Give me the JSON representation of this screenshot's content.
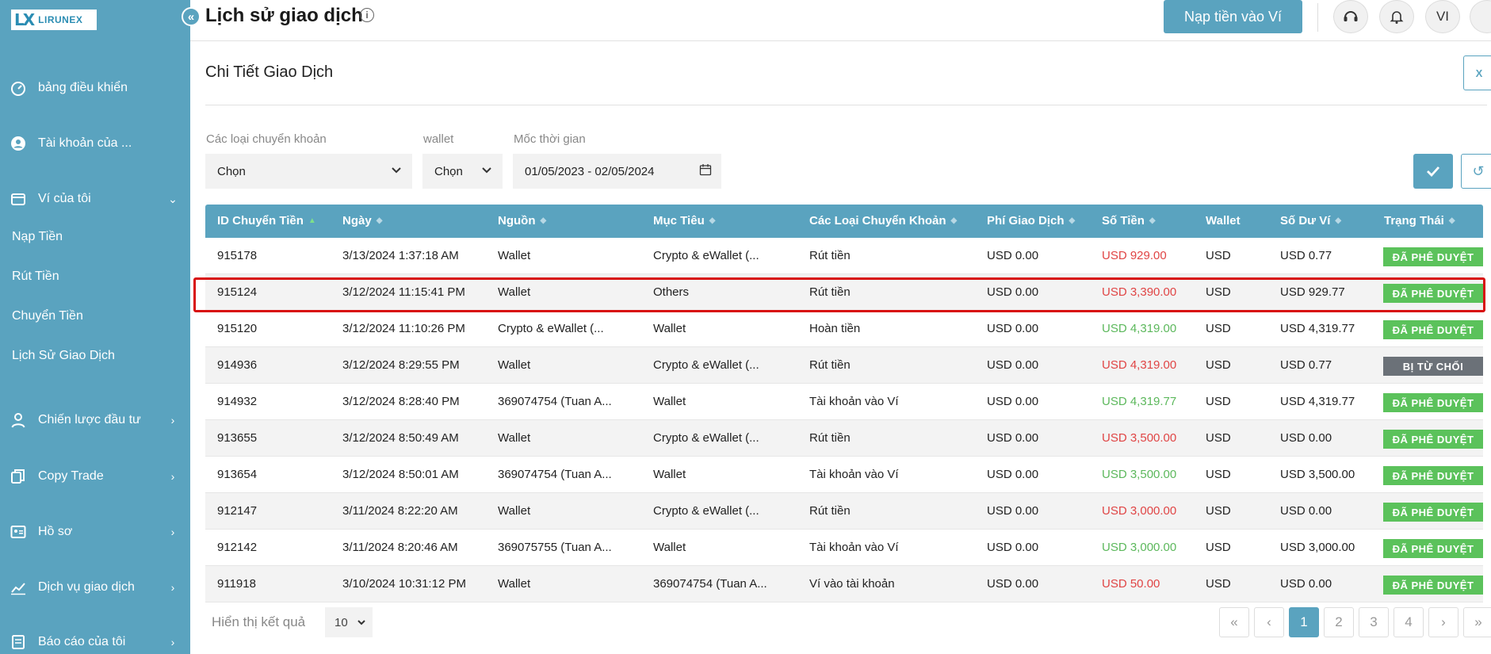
{
  "brand": {
    "logo_mark": "LX",
    "logo_text": "LIRUNEX"
  },
  "sidebar": {
    "items": [
      {
        "label": "bảng điều khiển",
        "icon": "dashboard-icon"
      },
      {
        "label": "Tài khoản của ...",
        "icon": "account-icon"
      },
      {
        "label": "Ví của tôi",
        "icon": "wallet-icon"
      },
      {
        "label": "Chiến lược đầu tư",
        "icon": "strategy-icon"
      },
      {
        "label": "Copy Trade",
        "icon": "copy-icon"
      },
      {
        "label": "Hồ sơ",
        "icon": "profile-icon"
      },
      {
        "label": "Dịch vụ giao dịch",
        "icon": "trading-icon"
      },
      {
        "label": "Báo cáo của tôi",
        "icon": "report-icon"
      }
    ],
    "wallet_subitems": [
      "Nạp Tiền",
      "Rút Tiền",
      "Chuyển Tiền",
      "Lịch Sử Giao Dịch"
    ]
  },
  "header": {
    "title": "Lịch sử giao dịch",
    "deposit_button": "Nạp tiền vào Ví",
    "language": "VI"
  },
  "section": {
    "title": "Chi Tiết Giao Dịch"
  },
  "filters": {
    "transfer_type": {
      "label": "Các loại chuyển khoản",
      "value": "Chọn"
    },
    "wallet": {
      "label": "wallet",
      "value": "Chọn"
    },
    "period": {
      "label": "Mốc thời gian",
      "value": "01/05/2023 - 02/05/2024"
    }
  },
  "table": {
    "columns": [
      "ID Chuyển Tiền",
      "Ngày",
      "Nguồn",
      "Mục Tiêu",
      "Các Loại Chuyển Khoản",
      "Phí Giao Dịch",
      "Số Tiền",
      "Wallet",
      "Số Dư Ví",
      "Trạng Thái"
    ],
    "rows": [
      {
        "id": "915178",
        "date": "3/13/2024 1:37:18 AM",
        "source": "Wallet",
        "target": "Crypto & eWallet (...",
        "type": "Rút tiền",
        "fee": "USD 0.00",
        "amount": "USD 929.00",
        "amount_color": "red",
        "wallet": "USD",
        "balance": "USD 0.77",
        "status": "ĐÃ PHÊ DUYỆT",
        "status_kind": "approved"
      },
      {
        "id": "915124",
        "date": "3/12/2024 11:15:41 PM",
        "source": "Wallet",
        "target": "Others",
        "type": "Rút tiền",
        "fee": "USD 0.00",
        "amount": "USD 3,390.00",
        "amount_color": "red",
        "wallet": "USD",
        "balance": "USD 929.77",
        "status": "ĐÃ PHÊ DUYỆT",
        "status_kind": "approved"
      },
      {
        "id": "915120",
        "date": "3/12/2024 11:10:26 PM",
        "source": "Crypto & eWallet (...",
        "target": "Wallet",
        "type": "Hoàn tiền",
        "fee": "USD 0.00",
        "amount": "USD 4,319.00",
        "amount_color": "green",
        "wallet": "USD",
        "balance": "USD 4,319.77",
        "status": "ĐÃ PHÊ DUYỆT",
        "status_kind": "approved"
      },
      {
        "id": "914936",
        "date": "3/12/2024 8:29:55 PM",
        "source": "Wallet",
        "target": "Crypto & eWallet (...",
        "type": "Rút tiền",
        "fee": "USD 0.00",
        "amount": "USD 4,319.00",
        "amount_color": "red",
        "wallet": "USD",
        "balance": "USD 0.77",
        "status": "BỊ TỪ CHỐI",
        "status_kind": "rejected"
      },
      {
        "id": "914932",
        "date": "3/12/2024 8:28:40 PM",
        "source": "369074754 (Tuan A...",
        "target": "Wallet",
        "type": "Tài khoản vào Ví",
        "fee": "USD 0.00",
        "amount": "USD 4,319.77",
        "amount_color": "green",
        "wallet": "USD",
        "balance": "USD 4,319.77",
        "status": "ĐÃ PHÊ DUYỆT",
        "status_kind": "approved"
      },
      {
        "id": "913655",
        "date": "3/12/2024 8:50:49 AM",
        "source": "Wallet",
        "target": "Crypto & eWallet (...",
        "type": "Rút tiền",
        "fee": "USD 0.00",
        "amount": "USD 3,500.00",
        "amount_color": "red",
        "wallet": "USD",
        "balance": "USD 0.00",
        "status": "ĐÃ PHÊ DUYỆT",
        "status_kind": "approved"
      },
      {
        "id": "913654",
        "date": "3/12/2024 8:50:01 AM",
        "source": "369074754 (Tuan A...",
        "target": "Wallet",
        "type": "Tài khoản vào Ví",
        "fee": "USD 0.00",
        "amount": "USD 3,500.00",
        "amount_color": "green",
        "wallet": "USD",
        "balance": "USD 3,500.00",
        "status": "ĐÃ PHÊ DUYỆT",
        "status_kind": "approved"
      },
      {
        "id": "912147",
        "date": "3/11/2024 8:22:20 AM",
        "source": "Wallet",
        "target": "Crypto & eWallet (...",
        "type": "Rút tiền",
        "fee": "USD 0.00",
        "amount": "USD 3,000.00",
        "amount_color": "red",
        "wallet": "USD",
        "balance": "USD 0.00",
        "status": "ĐÃ PHÊ DUYỆT",
        "status_kind": "approved"
      },
      {
        "id": "912142",
        "date": "3/11/2024 8:20:46 AM",
        "source": "369075755 (Tuan A...",
        "target": "Wallet",
        "type": "Tài khoản vào Ví",
        "fee": "USD 0.00",
        "amount": "USD 3,000.00",
        "amount_color": "green",
        "wallet": "USD",
        "balance": "USD 3,000.00",
        "status": "ĐÃ PHÊ DUYỆT",
        "status_kind": "approved"
      },
      {
        "id": "911918",
        "date": "3/10/2024 10:31:12 PM",
        "source": "Wallet",
        "target": "369074754 (Tuan A...",
        "type": "Ví vào tài khoản",
        "fee": "USD 0.00",
        "amount": "USD 50.00",
        "amount_color": "red",
        "wallet": "USD",
        "balance": "USD 0.00",
        "status": "ĐÃ PHÊ DUYỆT",
        "status_kind": "approved"
      }
    ]
  },
  "footer": {
    "results_label": "Hiển thị kết quả",
    "page_size": "10",
    "pages": [
      "1",
      "2",
      "3",
      "4"
    ],
    "current_page": "1"
  },
  "colors": {
    "accent": "#5aa3bf",
    "approved": "#5bc25b",
    "rejected": "#6b7178",
    "negative": "#e04545",
    "positive": "#5cb85c",
    "highlight": "#d80f0f"
  }
}
